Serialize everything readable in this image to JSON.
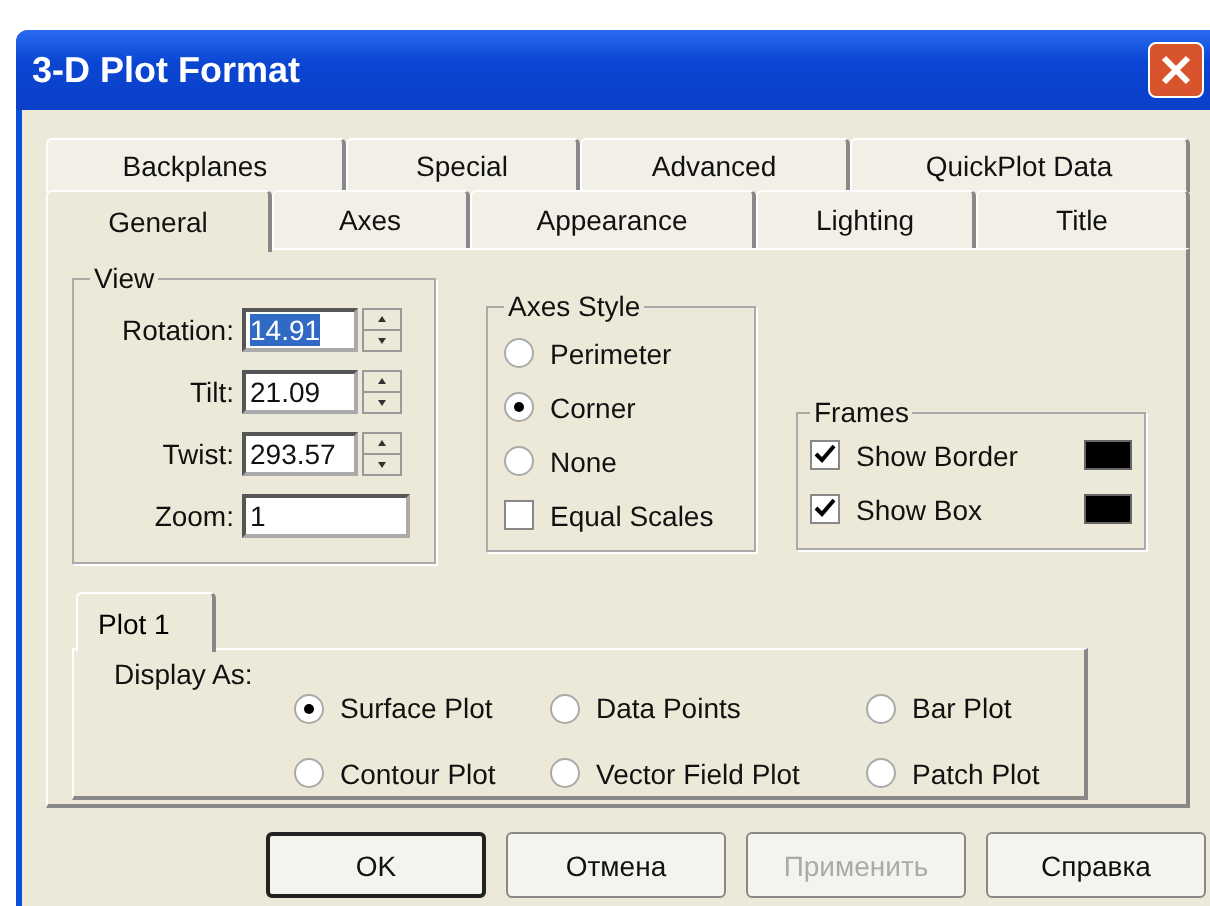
{
  "window": {
    "title": "3-D Plot Format"
  },
  "tab_rows": [
    [
      {
        "label": "Backplanes",
        "selected": false
      },
      {
        "label": "Special",
        "selected": false
      },
      {
        "label": "Advanced",
        "selected": false
      },
      {
        "label": "QuickPlot Data",
        "selected": false
      }
    ],
    [
      {
        "label": "General",
        "selected": true
      },
      {
        "label": "Axes",
        "selected": false
      },
      {
        "label": "Appearance",
        "selected": false
      },
      {
        "label": "Lighting",
        "selected": false
      },
      {
        "label": "Title",
        "selected": false
      }
    ]
  ],
  "view": {
    "title": "View",
    "fields": [
      {
        "label": "Rotation:",
        "value": "14.91",
        "kind": "spin",
        "highlighted": true
      },
      {
        "label": "Tilt:",
        "value": "21.09",
        "kind": "spin",
        "highlighted": false
      },
      {
        "label": "Twist:",
        "value": "293.57",
        "kind": "spin",
        "highlighted": false
      },
      {
        "label": "Zoom:",
        "value": "1",
        "kind": "text",
        "highlighted": false
      }
    ]
  },
  "axes_style": {
    "title": "Axes Style",
    "options": [
      {
        "label": "Perimeter",
        "selected": false
      },
      {
        "label": "Corner",
        "selected": true
      },
      {
        "label": "None",
        "selected": false
      }
    ],
    "equal_scales": {
      "label": "Equal Scales",
      "checked": false
    }
  },
  "frames": {
    "title": "Frames",
    "items": [
      {
        "label": "Show Border",
        "checked": true,
        "color": "#000000"
      },
      {
        "label": "Show Box",
        "checked": true,
        "color": "#000000"
      }
    ]
  },
  "plot_tabs": [
    {
      "label": "Plot 1",
      "selected": true
    }
  ],
  "display_as": {
    "label": "Display As:",
    "options": [
      {
        "label": "Surface Plot",
        "selected": true
      },
      {
        "label": "Data Points",
        "selected": false
      },
      {
        "label": "Bar Plot",
        "selected": false
      },
      {
        "label": "Contour Plot",
        "selected": false
      },
      {
        "label": "Vector Field Plot",
        "selected": false
      },
      {
        "label": "Patch Plot",
        "selected": false
      }
    ]
  },
  "buttons": [
    {
      "label": "OK",
      "default": true,
      "disabled": false
    },
    {
      "label": "Отмена",
      "default": false,
      "disabled": false
    },
    {
      "label": "Применить",
      "default": false,
      "disabled": true
    },
    {
      "label": "Справка",
      "default": false,
      "disabled": false
    }
  ]
}
